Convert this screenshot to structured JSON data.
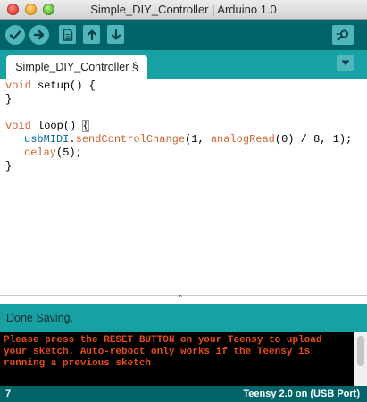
{
  "window": {
    "title": "Simple_DIY_Controller | Arduino 1.0"
  },
  "toolbar": {
    "buttons": [
      {
        "name": "verify",
        "icon": "checkmark-icon"
      },
      {
        "name": "upload",
        "icon": "right-arrow-icon"
      },
      {
        "name": "new",
        "icon": "new-document-icon"
      },
      {
        "name": "open",
        "icon": "up-arrow-icon"
      },
      {
        "name": "save",
        "icon": "down-arrow-icon"
      },
      {
        "name": "serial-monitor",
        "icon": "magnifier-icon"
      }
    ]
  },
  "tabs": [
    {
      "label": "Simple_DIY_Controller §",
      "active": true
    }
  ],
  "editor": {
    "lines": {
      "l1_kw": "void",
      "l1_rest": " setup() {",
      "l2": "}",
      "l4_kw": "void",
      "l4_rest": " loop() ",
      "l4_brace": "{",
      "l5_obj": "usbMIDI",
      "l5_dot": ".",
      "l5_fn": "sendControlChange",
      "l5_args1": "(1, ",
      "l5_fn2": "analogRead",
      "l5_args2": "(0) / 8, 1);",
      "l6_fn": "delay",
      "l6_args": "(5);",
      "l7": "}"
    }
  },
  "status": {
    "message": "Done Saving."
  },
  "console": {
    "text": "Please press the RESET BUTTON on your Teensy to upload your sketch.  Auto-reboot only works if the Teensy is running a previous sketch."
  },
  "footer": {
    "line": "7",
    "board": "Teensy 2.0 on (USB Port)"
  },
  "colors": {
    "toolbar": "#006468",
    "tabbar": "#17a1a5",
    "button": "#4db7bb",
    "console_text": "#e34c1a",
    "keyword": "#cc6633"
  }
}
